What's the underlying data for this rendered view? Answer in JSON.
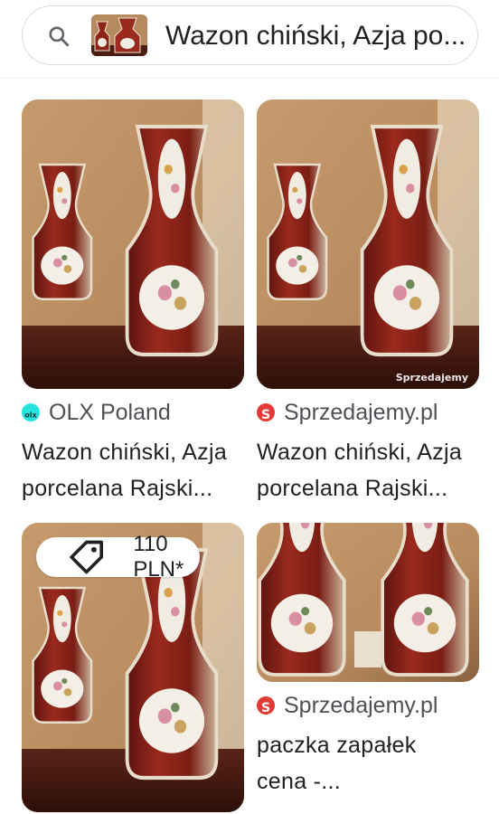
{
  "search": {
    "query": "Wazon chiński, Azja po..."
  },
  "results": [
    {
      "source": "OLX Poland",
      "source_icon": "olx-logo-icon",
      "source_icon_color": "#23e5db",
      "title": "Wazon chiński, Azja\nporcelana Rajski..."
    },
    {
      "source": "Sprzedajemy.pl",
      "source_icon": "sprzedajemy-logo-icon",
      "source_icon_color": "#e53935",
      "title": "Wazon chiński, Azja\nporcelana Rajski...",
      "watermark": "Sprzedajemy"
    },
    {
      "price": "110 PLN*",
      "price_icon": "tag-icon"
    },
    {
      "source": "Sprzedajemy.pl",
      "source_icon": "sprzedajemy-logo-icon",
      "source_icon_color": "#e53935",
      "title": "paczka zapałek\ncena -..."
    }
  ]
}
